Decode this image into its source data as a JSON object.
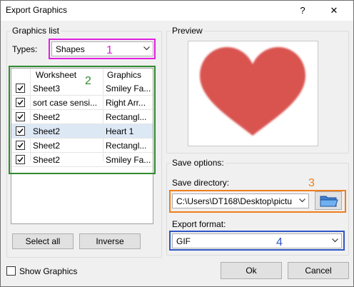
{
  "window": {
    "title": "Export Graphics",
    "help_glyph": "?",
    "close_glyph": "✕"
  },
  "graphics_list": {
    "group_label": "Graphics list",
    "types_label": "Types:",
    "types_value": "Shapes",
    "columns": [
      "Worksheet",
      "Graphics"
    ],
    "rows": [
      {
        "checked": true,
        "worksheet": "Sheet3",
        "graphic": "Smiley Fa...",
        "selected": false
      },
      {
        "checked": true,
        "worksheet": "sort case sensi...",
        "graphic": "Right Arr...",
        "selected": false
      },
      {
        "checked": true,
        "worksheet": "Sheet2",
        "graphic": "Rectangl...",
        "selected": false
      },
      {
        "checked": true,
        "worksheet": "Sheet2",
        "graphic": "Heart 1",
        "selected": true
      },
      {
        "checked": true,
        "worksheet": "Sheet2",
        "graphic": "Rectangl...",
        "selected": false
      },
      {
        "checked": true,
        "worksheet": "Sheet2",
        "graphic": "Smiley Fa...",
        "selected": false
      }
    ],
    "select_all_label": "Select all",
    "inverse_label": "Inverse"
  },
  "preview": {
    "group_label": "Preview",
    "heart_color": "#d9534f"
  },
  "save_options": {
    "group_label": "Save options:",
    "directory_label": "Save directory:",
    "directory_value": "C:\\Users\\DT168\\Desktop\\pictu",
    "format_label": "Export format:",
    "format_value": "GIF",
    "browse_icon": "folder-icon"
  },
  "footer": {
    "show_graphics_label": "Show Graphics",
    "show_graphics_checked": false,
    "ok_label": "Ok",
    "cancel_label": "Cancel"
  },
  "annotations": {
    "n1": "1",
    "n2": "2",
    "n3": "3",
    "n4": "4",
    "color1": "#e020e0",
    "color2": "#2e8b2e",
    "color3": "#f07d1a",
    "color4": "#2f56c8"
  }
}
